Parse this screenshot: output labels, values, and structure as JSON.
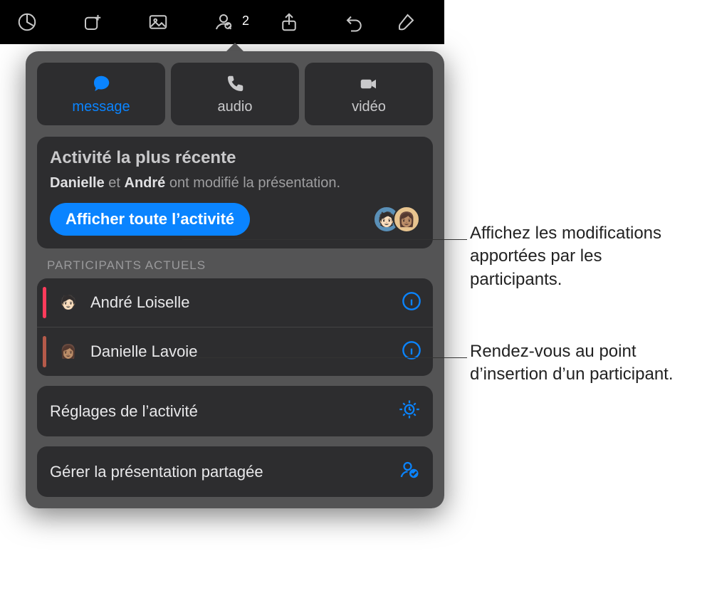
{
  "toolbar": {
    "collab_count": "2"
  },
  "segmented": {
    "message": "message",
    "audio": "audio",
    "video": "vidéo"
  },
  "activity": {
    "title": "Activité la plus récente",
    "name1": "Danielle",
    "conj": " et ",
    "name2": "André",
    "suffix": " ont modifié la présentation.",
    "show_all": "Afficher toute l’activité"
  },
  "participants": {
    "header": "PARTICIPANTS ACTUELS",
    "items": [
      {
        "name": "André Loiselle"
      },
      {
        "name": "Danielle Lavoie"
      }
    ]
  },
  "settings": {
    "activity": "Réglages de l’activité",
    "manage": "Gérer la présentation partagée"
  },
  "callouts": {
    "c1": "Affichez les modifications apportées par les participants.",
    "c2": "Rendez-vous au point d’insertion d’un participant."
  }
}
